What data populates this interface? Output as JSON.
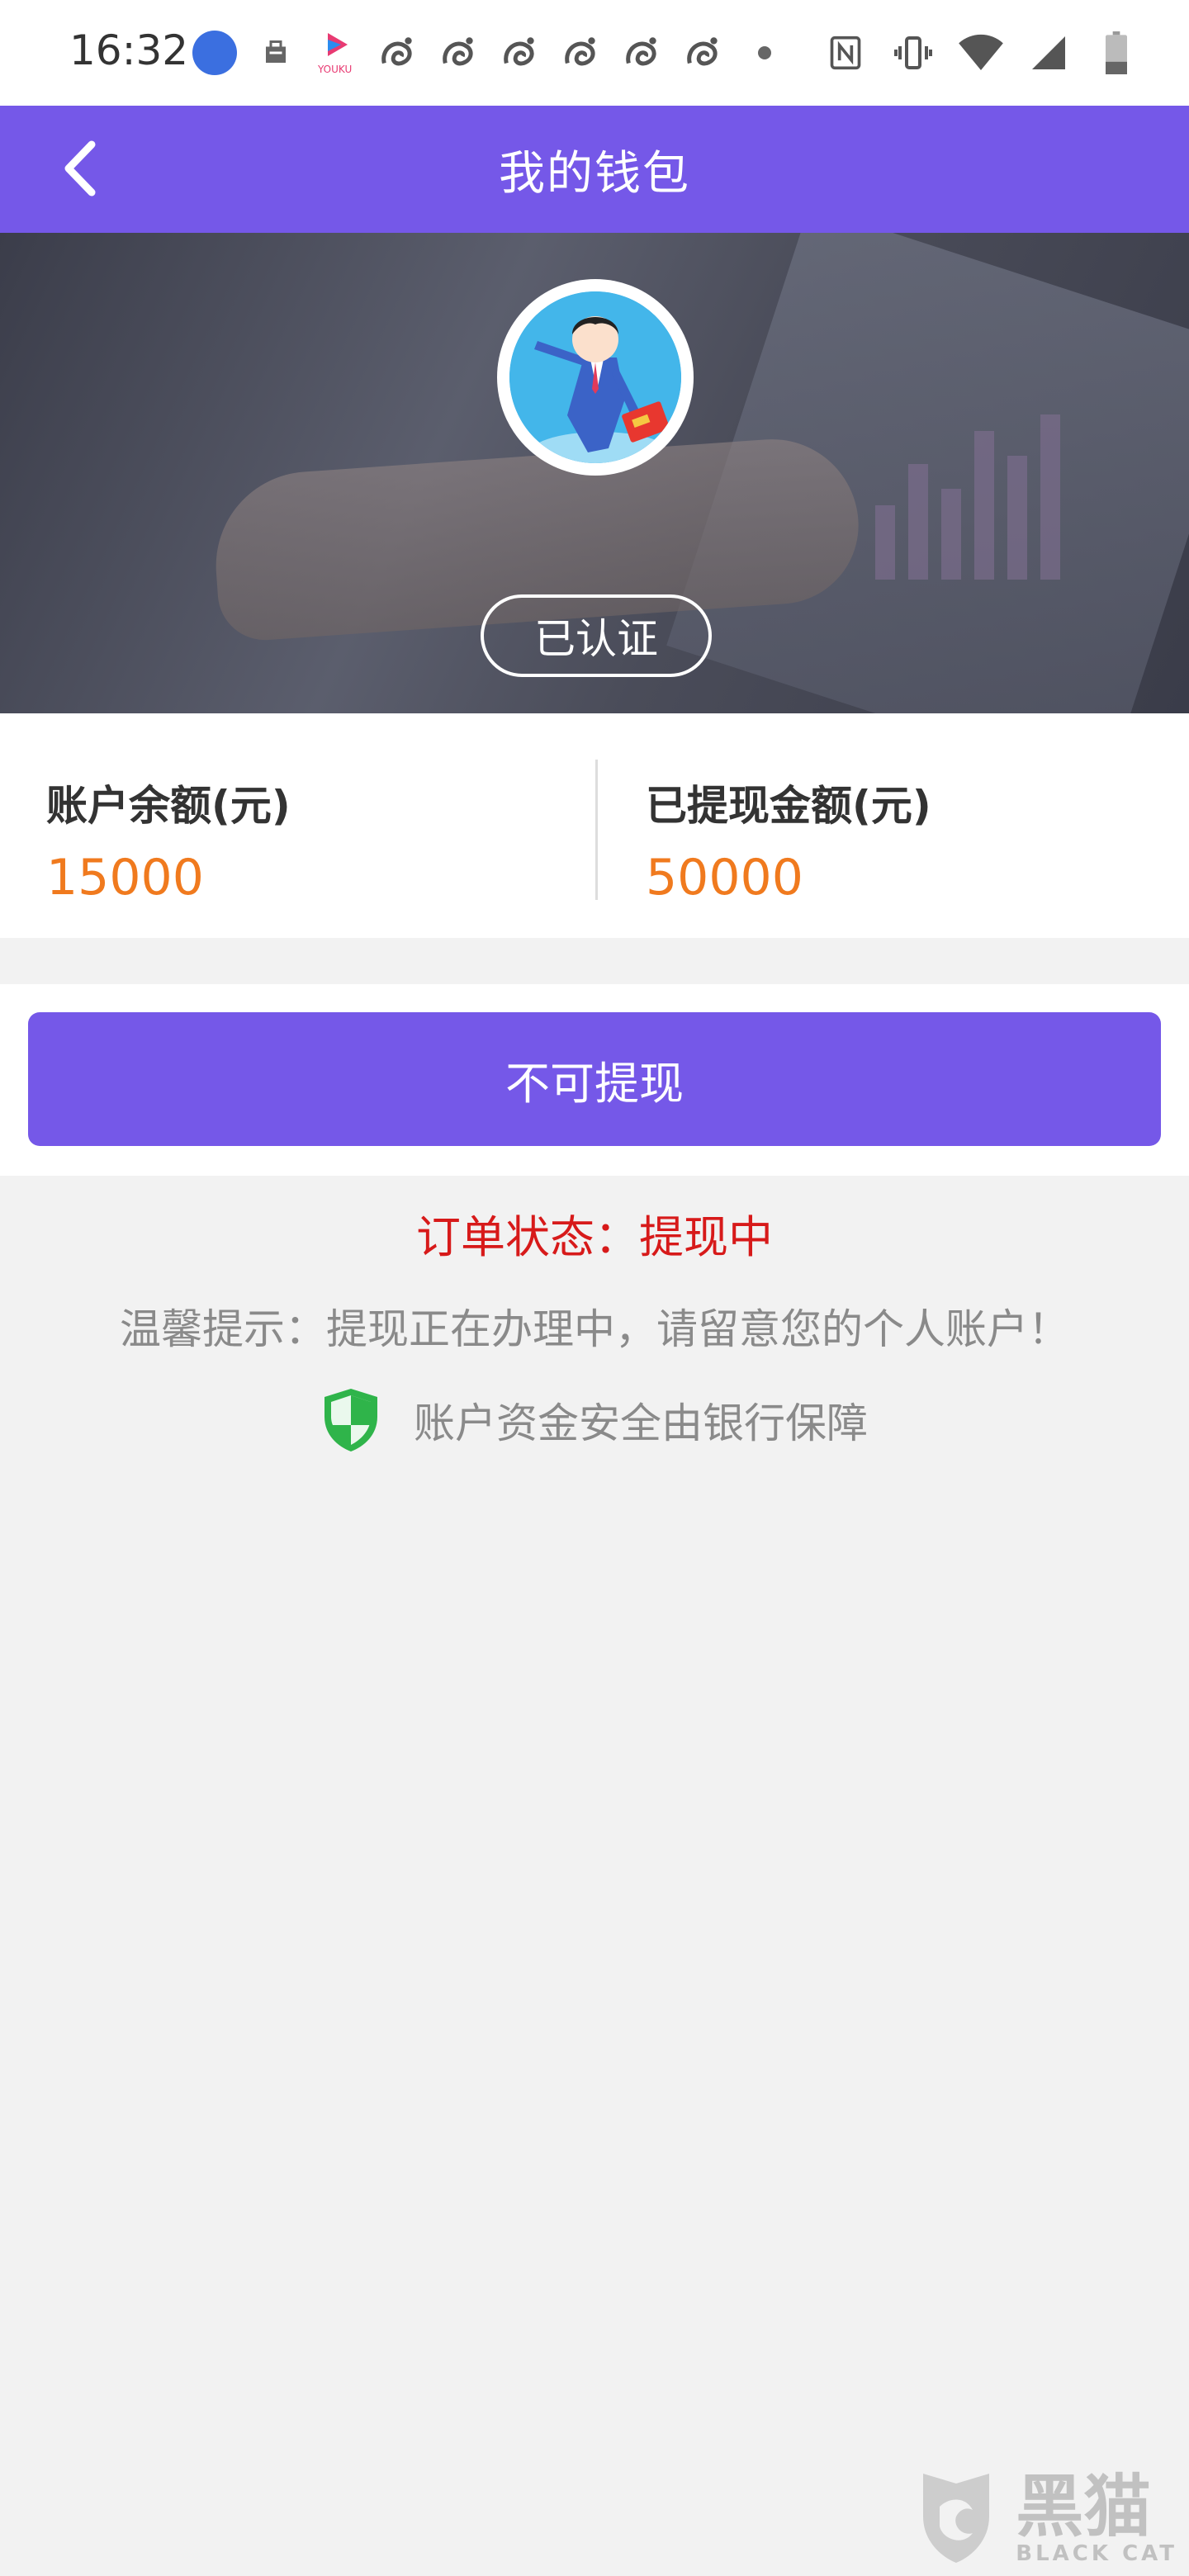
{
  "status_bar": {
    "time": "16:32",
    "left_icons": [
      "app-circle-icon",
      "bag-icon",
      "youku-icon",
      "uc-icon",
      "uc-icon",
      "uc-icon",
      "uc-icon",
      "uc-icon",
      "uc-icon",
      "dot-icon"
    ],
    "youku_label": "YOUKU",
    "right_icons": [
      "nfc-icon",
      "vibrate-icon",
      "wifi-icon",
      "signal-icon",
      "battery-icon"
    ]
  },
  "header": {
    "title": "我的钱包",
    "back_icon": "chevron-left-icon"
  },
  "profile": {
    "verified_label": "已认证"
  },
  "balance": {
    "account_label": "账户余额(元)",
    "account_value": "15000",
    "withdrawn_label": "已提现金额(元)",
    "withdrawn_value": "50000"
  },
  "action": {
    "withdraw_button_label": "不可提现"
  },
  "order": {
    "status_text": "订单状态：提现中"
  },
  "tips": {
    "reminder": "温馨提示：提现正在办理中，请留意您的个人账户！",
    "security": "账户资金安全由银行保障",
    "security_icon": "shield-check-icon"
  },
  "watermark": {
    "main": "黑猫",
    "sub": "BLACK CAT"
  },
  "colors": {
    "primary": "#7558e8",
    "amount": "#f07a1e",
    "status_red": "#d71a1a",
    "tip_gray": "#8a8a8a",
    "shield_green": "#2fb44a"
  }
}
